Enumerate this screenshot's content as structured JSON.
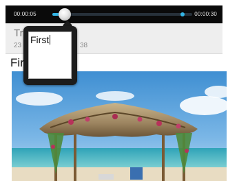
{
  "player": {
    "elapsed": "00:00:05",
    "duration": "00:00:30",
    "progress_fraction": 0.09,
    "buffered_fraction": 0.93,
    "accent": "#33b5e5",
    "bar_color": "#0a0a0a"
  },
  "header": {
    "title_partial": "Tri",
    "date_partial_start": "23",
    "date_partial_end": "38",
    "strip_color": "#eeeeee"
  },
  "caption": {
    "title_partial": "Fir"
  },
  "text_popup": {
    "value": "First",
    "popup_color": "#1c1c1c"
  },
  "photo": {
    "subject": "beach-hut-photo"
  }
}
